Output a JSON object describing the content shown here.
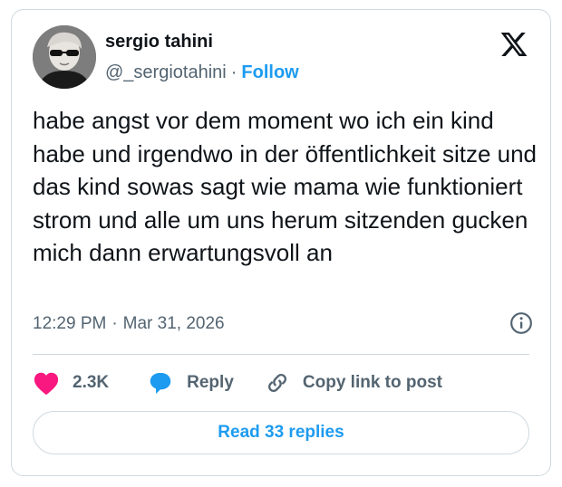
{
  "author": {
    "name": "sergio tahini",
    "handle": "@_sergiotahini",
    "separator": "·",
    "follow_label": "Follow"
  },
  "tweet": {
    "text": "habe angst vor dem moment wo ich ein kind habe und irgendwo in der öffentlichkeit sitze und das kind sowas sagt wie mama wie funktioniert strom und alle um uns herum sitzenden gucken mich dann erwartungsvoll an",
    "time": "12:29 PM",
    "meta_separator": "·",
    "date": "Mar 31, 2026"
  },
  "actions": {
    "likes_count": "2.3K",
    "reply_label": "Reply",
    "copy_label": "Copy link to post"
  },
  "read_replies_label": "Read 33 replies",
  "icons": {
    "logo": "x-logo-icon",
    "info": "info-icon",
    "like": "heart-icon",
    "reply": "speech-bubble-icon",
    "copy": "link-icon"
  },
  "colors": {
    "accent": "#1d9bf0",
    "heart": "#f91880",
    "text": "#0f1419",
    "muted": "#536471",
    "border": "#cfd9de"
  }
}
